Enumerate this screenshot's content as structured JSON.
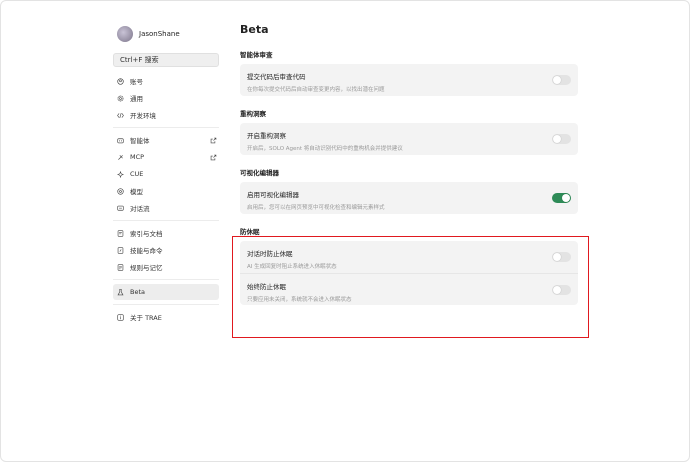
{
  "sidebar": {
    "username": "JasonShane",
    "search_label": "Ctrl+F 搜索",
    "groups": [
      [
        {
          "label": "账号",
          "icon": "account-icon"
        },
        {
          "label": "通用",
          "icon": "gear-icon"
        },
        {
          "label": "开发环境",
          "icon": "code-icon"
        }
      ],
      [
        {
          "label": "智能体",
          "icon": "agent-icon",
          "external": true
        },
        {
          "label": "MCP",
          "icon": "mcp-icon",
          "external": true
        },
        {
          "label": "CUE",
          "icon": "cue-icon"
        },
        {
          "label": "模型",
          "icon": "model-icon"
        },
        {
          "label": "对话流",
          "icon": "chat-flow-icon"
        }
      ],
      [
        {
          "label": "索引与文档",
          "icon": "index-icon"
        },
        {
          "label": "技能与命令",
          "icon": "skills-icon"
        },
        {
          "label": "规则与记忆",
          "icon": "rules-icon"
        }
      ],
      [
        {
          "label": "Beta",
          "icon": "beta-icon",
          "active": true
        }
      ],
      [
        {
          "label": "关于 TRAE",
          "icon": "info-icon"
        }
      ]
    ]
  },
  "main": {
    "title": "Beta",
    "sections": [
      {
        "title": "智能体审查",
        "rows": [
          {
            "title": "提交代码后审查代码",
            "desc": "在你每次提交代码后自动审查变更内容，以找出潜在问题",
            "enabled": false
          }
        ]
      },
      {
        "title": "重构洞察",
        "rows": [
          {
            "title": "开启重构洞察",
            "desc": "开启后，SOLO Agent 将自动识别代码中的重构机会并提供建议",
            "enabled": false
          }
        ]
      },
      {
        "title": "可视化编辑器",
        "rows": [
          {
            "title": "启用可视化编辑器",
            "desc": "启用后，您可以在网页预览中可视化检查和编辑元素样式",
            "enabled": true
          }
        ]
      },
      {
        "title": "防休眠",
        "rows": [
          {
            "title": "对话时防止休眠",
            "desc": "AI 生成回复时阻止系统进入休眠状态",
            "enabled": false
          },
          {
            "title": "始终防止休眠",
            "desc": "只要应用未关闭，系统就不会进入休眠状态",
            "enabled": false
          }
        ]
      }
    ]
  },
  "colors": {
    "highlight": "#e0191f",
    "toggle_on": "#2e8b57",
    "toggle_off": "#e3e3e3"
  }
}
